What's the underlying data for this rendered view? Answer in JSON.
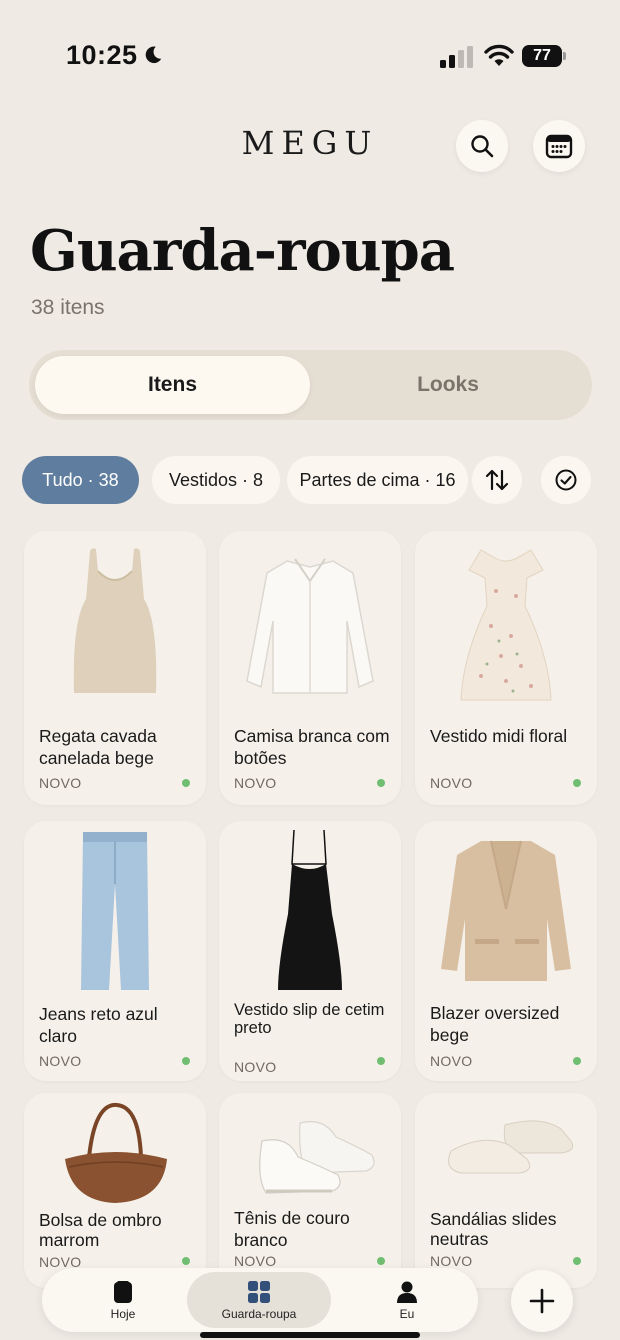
{
  "status": {
    "time": "10:25",
    "battery": "77"
  },
  "header": {
    "logo": "MEGU"
  },
  "page": {
    "title": "Guarda-roupa",
    "count": "38 itens"
  },
  "segments": {
    "active": "Itens",
    "inactive": "Looks"
  },
  "filters": {
    "all": "Tudo · 38",
    "dresses": "Vestidos · 8",
    "tops": "Partes de cima · 16"
  },
  "items": [
    {
      "name": "Regata cavada canelada bege",
      "tag": "NOVO"
    },
    {
      "name": "Camisa branca com botões",
      "tag": "NOVO"
    },
    {
      "name": "Vestido midi floral",
      "tag": "NOVO"
    },
    {
      "name": "Jeans reto azul claro",
      "tag": "NOVO"
    },
    {
      "name": "Vestido slip de cetim preto",
      "tag": "NOVO"
    },
    {
      "name": "Blazer oversized bege",
      "tag": "NOVO"
    },
    {
      "name": "Bolsa de ombro marrom",
      "tag": "NOVO"
    },
    {
      "name": "Tênis de couro branco",
      "tag": "NOVO"
    },
    {
      "name": "Sandálias slides neutras",
      "tag": "NOVO"
    }
  ],
  "tabbar": {
    "today": "Hoje",
    "wardrobe": "Guarda-roupa",
    "me": "Eu"
  },
  "colors": {
    "accent": "#5F7E9F",
    "background": "#EFEAE4",
    "new_dot": "#6FBE71"
  }
}
